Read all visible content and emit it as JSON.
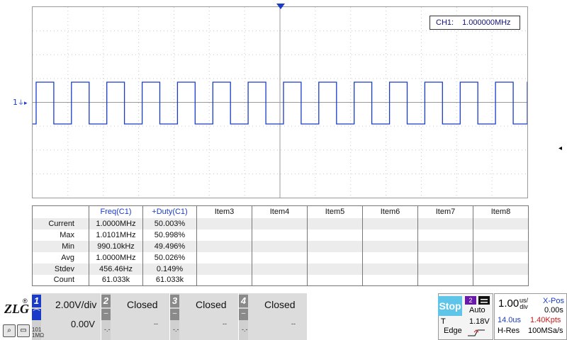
{
  "waveform": {
    "color": "#1a3bc8",
    "channel_marker": "1",
    "cycles": 14
  },
  "freq_box": {
    "label": "CH1:",
    "value": "1.000000MHz"
  },
  "measurements": {
    "headers": [
      "",
      "Freq(C1)",
      "+Duty(C1)",
      "Item3",
      "Item4",
      "Item5",
      "Item6",
      "Item7",
      "Item8"
    ],
    "rows": [
      {
        "label": "Current",
        "freq": "1.0000MHz",
        "duty": "50.003%"
      },
      {
        "label": "Max",
        "freq": "1.0101MHz",
        "duty": "50.998%"
      },
      {
        "label": "Min",
        "freq": "990.10kHz",
        "duty": "49.496%"
      },
      {
        "label": "Avg",
        "freq": "1.0000MHz",
        "duty": "50.026%"
      },
      {
        "label": "Stdev",
        "freq": "456.46Hz",
        "duty": "0.149%"
      },
      {
        "label": "Count",
        "freq": "61.033k",
        "duty": "61.033k"
      }
    ]
  },
  "channels": [
    {
      "num": "1",
      "scale": "2.00V/div",
      "offset": "0.00V",
      "impedance": "1MΩ",
      "coupling_mark": "101",
      "color": "#1a3bc8"
    },
    {
      "num": "2",
      "status": "Closed",
      "offset_left": "-.-",
      "offset_right": "--"
    },
    {
      "num": "3",
      "status": "Closed",
      "offset_left": "-.-",
      "offset_right": "--"
    },
    {
      "num": "4",
      "status": "Closed",
      "offset_left": "-.-",
      "offset_right": "--"
    }
  ],
  "run_state": "Stop",
  "trigger": {
    "source": "2",
    "mode": "Auto",
    "t_label": "T",
    "level": "1.18V",
    "type": "Edge",
    "icon": "rising-edge-icon"
  },
  "timebase": {
    "scale": "1.00",
    "unit_top": "us/",
    "unit_bottom": "div",
    "xpos_label": "X-Pos",
    "xpos_value": "0.00s",
    "time_span": "14.0us",
    "points": "1.40Kpts",
    "acq_mode": "H-Res",
    "sample_rate": "100MSa/s"
  },
  "logo": {
    "text": "ZLG",
    "reg": "®"
  }
}
